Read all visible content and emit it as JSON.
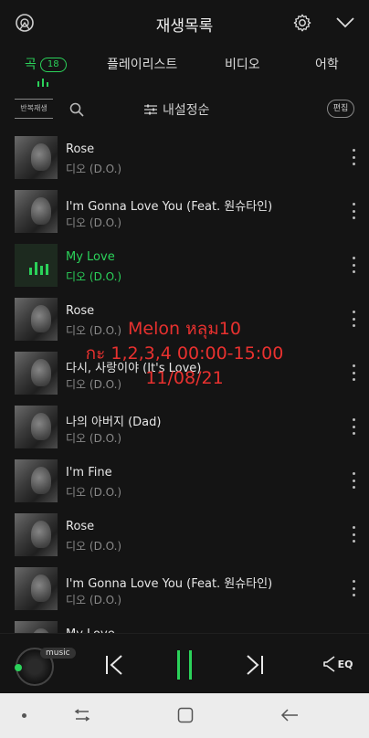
{
  "header": {
    "title": "재생목록"
  },
  "tabs": [
    {
      "label": "곡",
      "badge": "18",
      "active": true
    },
    {
      "label": "플레이리스트",
      "active": false
    },
    {
      "label": "비디오",
      "active": false
    },
    {
      "label": "어학",
      "active": false
    }
  ],
  "controls": {
    "repeat_label": "반복재생",
    "sort_label": "내설정순",
    "edit_label": "편집"
  },
  "songs": [
    {
      "title": "Rose",
      "artist": "디오 (D.O.)",
      "playing": false
    },
    {
      "title": "I'm Gonna Love You (Feat. 원슈타인)",
      "artist": "디오 (D.O.)",
      "playing": false
    },
    {
      "title": "My Love",
      "artist": "디오 (D.O.)",
      "playing": true
    },
    {
      "title": "Rose",
      "artist": "디오 (D.O.)",
      "playing": false
    },
    {
      "title": "다시, 사랑이야 (It's Love)",
      "artist": "디오 (D.O.)",
      "playing": false
    },
    {
      "title": "나의 아버지 (Dad)",
      "artist": "디오 (D.O.)",
      "playing": false
    },
    {
      "title": "I'm Fine",
      "artist": "디오 (D.O.)",
      "playing": false
    },
    {
      "title": "Rose",
      "artist": "디오 (D.O.)",
      "playing": false
    },
    {
      "title": "I'm Gonna Love You (Feat. 원슈타인)",
      "artist": "디오 (D.O.)",
      "playing": false
    },
    {
      "title": "My Love",
      "artist": "",
      "playing": false
    }
  ],
  "overlay": {
    "line1": "Melon หลุม10",
    "line2": "กะ 1,2,3,4 00:00-15:00",
    "line3": "11/08/21"
  },
  "player": {
    "music_label": "music",
    "eq_label": "EQ"
  },
  "colors": {
    "accent": "#2bd25a",
    "background": "#141414",
    "overlay_text": "#e8312f"
  }
}
